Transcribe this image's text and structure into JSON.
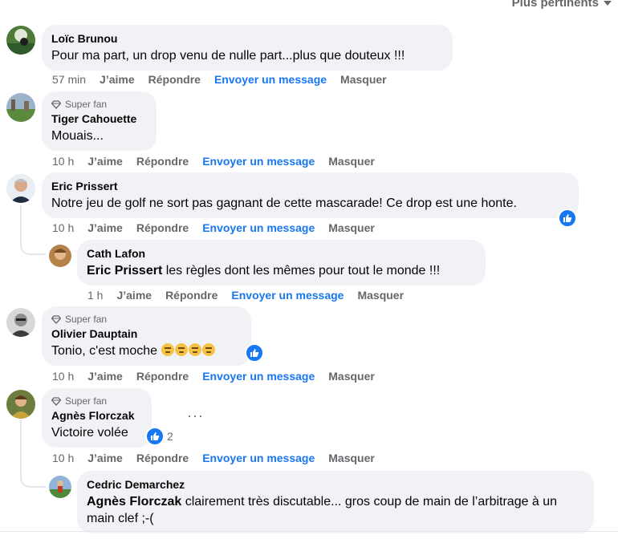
{
  "sort": {
    "label": "Plus pertinents"
  },
  "actions": {
    "like": "J’aime",
    "reply": "Répondre",
    "message": "Envoyer un message",
    "hide": "Masquer"
  },
  "comments": [
    {
      "name": "Loïc Brunou",
      "text": "Pour ma part, un drop venu de nulle part...plus que douteux !!!",
      "time": "57 min"
    },
    {
      "badge": "Super fan",
      "name": "Tiger Cahouette",
      "text": "Mouais...",
      "time": "10 h"
    },
    {
      "name": "Eric Prissert",
      "text": "Notre jeu de golf ne sort pas gagnant de cette mascarade! Ce drop est une honte.",
      "time": "10 h"
    },
    {
      "name": "Cath Lafon",
      "mention": "Eric Prissert",
      "text": " les règles dont les mêmes pour tout le monde !!!",
      "time": "1 h"
    },
    {
      "badge": "Super fan",
      "name": "Olivier Dauptain",
      "text": "Tonio, c'est moche ",
      "time": "10 h"
    },
    {
      "badge": "Super fan",
      "name": "Agnès Florczak",
      "text": "Victoire volée",
      "reaction_count": "2",
      "time": "10 h"
    },
    {
      "name": "Cedric Demarchez",
      "mention": "Agnès Florczak",
      "text": " clairement très discutable... gros coup de main de l’arbitrage à un main clef ;-("
    }
  ],
  "colors": {
    "accent": "#1877f2",
    "bubble": "#f0f2f5",
    "muted": "#65676b"
  }
}
